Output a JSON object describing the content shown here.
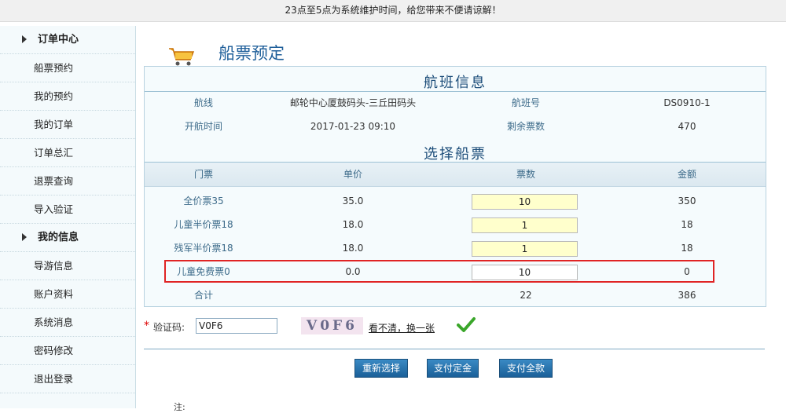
{
  "notice": "23点至5点为系统维护时间，给您带来不便请谅解！",
  "sidebar": {
    "groups": [
      {
        "title": "订单中心",
        "items": [
          "船票预约",
          "我的预约",
          "我的订单",
          "订单总汇",
          "退票查询",
          "导入验证"
        ]
      },
      {
        "title": "我的信息",
        "items": [
          "导游信息",
          "账户资料",
          "系统消息",
          "密码修改",
          "退出登录"
        ]
      }
    ]
  },
  "page": {
    "title": "船票预定"
  },
  "flight": {
    "section_title": "航班信息",
    "route_label": "航线",
    "route_value": "邮轮中心厦鼓码头-三丘田码头",
    "no_label": "航班号",
    "no_value": "DS0910-1",
    "time_label": "开航时间",
    "time_value": "2017-01-23 09:10",
    "remain_label": "剩余票数",
    "remain_value": "470"
  },
  "tickets": {
    "section_title": "选择船票",
    "headers": [
      "门票",
      "单价",
      "票数",
      "金额"
    ],
    "rows": [
      {
        "name": "全价票35",
        "price": "35.0",
        "qty": "10",
        "amount": "350"
      },
      {
        "name": "儿童半价票18",
        "price": "18.0",
        "qty": "1",
        "amount": "18"
      },
      {
        "name": "残军半价票18",
        "price": "18.0",
        "qty": "1",
        "amount": "18"
      },
      {
        "name": "儿童免费票0",
        "price": "0.0",
        "qty": "10",
        "amount": "0"
      }
    ],
    "total_label": "合计",
    "total_qty": "22",
    "total_amount": "386"
  },
  "captcha": {
    "label": "验证码:",
    "value": "V0F6",
    "image_text": "V0F6",
    "refresh_text": "看不清，换一张"
  },
  "buttons": {
    "reselect": "重新选择",
    "pay_deposit": "支付定金",
    "pay_full": "支付全款"
  },
  "footnote": "注:"
}
